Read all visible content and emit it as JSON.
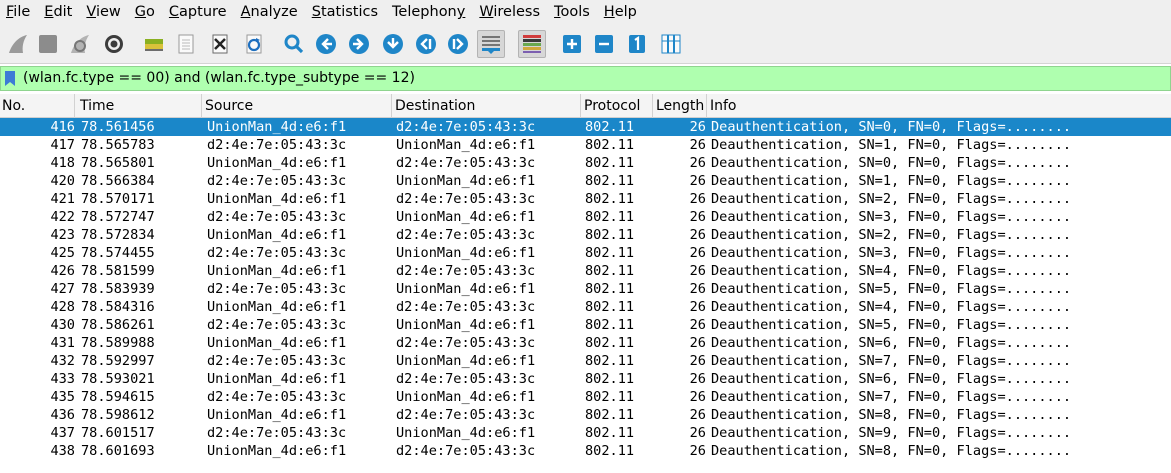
{
  "menu": [
    {
      "mnemonic": "F",
      "rest": "ile"
    },
    {
      "mnemonic": "E",
      "rest": "dit"
    },
    {
      "mnemonic": "V",
      "rest": "iew"
    },
    {
      "mnemonic": "G",
      "rest": "o"
    },
    {
      "mnemonic": "C",
      "rest": "apture"
    },
    {
      "mnemonic": "A",
      "rest": "nalyze"
    },
    {
      "mnemonic": "S",
      "rest": "tatistics"
    },
    {
      "mnemonic": "",
      "rest": "Telephon",
      "mnemonic_after": "y"
    },
    {
      "mnemonic": "W",
      "rest": "ireless"
    },
    {
      "mnemonic": "T",
      "rest": "ools"
    },
    {
      "mnemonic": "H",
      "rest": "elp"
    }
  ],
  "filter": {
    "expression": "(wlan.fc.type == 00) and (wlan.fc.type_subtype == 12)",
    "background": "#afffaf"
  },
  "columns": [
    "No.",
    "Time",
    "Source",
    "Destination",
    "Protocol",
    "Length",
    "Info"
  ],
  "selection_color": "#1a87c9",
  "rows": [
    {
      "no": "416",
      "time": "78.561456",
      "src": "UnionMan_4d:e6:f1",
      "dst": "d2:4e:7e:05:43:3c",
      "proto": "802.11",
      "len": "26",
      "info": "Deauthentication, SN=0, FN=0, Flags=........",
      "selected": true
    },
    {
      "no": "417",
      "time": "78.565783",
      "src": "d2:4e:7e:05:43:3c",
      "dst": "UnionMan_4d:e6:f1",
      "proto": "802.11",
      "len": "26",
      "info": "Deauthentication, SN=1, FN=0, Flags=........"
    },
    {
      "no": "418",
      "time": "78.565801",
      "src": "UnionMan_4d:e6:f1",
      "dst": "d2:4e:7e:05:43:3c",
      "proto": "802.11",
      "len": "26",
      "info": "Deauthentication, SN=0, FN=0, Flags=........"
    },
    {
      "no": "420",
      "time": "78.566384",
      "src": "d2:4e:7e:05:43:3c",
      "dst": "UnionMan_4d:e6:f1",
      "proto": "802.11",
      "len": "26",
      "info": "Deauthentication, SN=1, FN=0, Flags=........"
    },
    {
      "no": "421",
      "time": "78.570171",
      "src": "UnionMan_4d:e6:f1",
      "dst": "d2:4e:7e:05:43:3c",
      "proto": "802.11",
      "len": "26",
      "info": "Deauthentication, SN=2, FN=0, Flags=........"
    },
    {
      "no": "422",
      "time": "78.572747",
      "src": "d2:4e:7e:05:43:3c",
      "dst": "UnionMan_4d:e6:f1",
      "proto": "802.11",
      "len": "26",
      "info": "Deauthentication, SN=3, FN=0, Flags=........"
    },
    {
      "no": "423",
      "time": "78.572834",
      "src": "UnionMan_4d:e6:f1",
      "dst": "d2:4e:7e:05:43:3c",
      "proto": "802.11",
      "len": "26",
      "info": "Deauthentication, SN=2, FN=0, Flags=........"
    },
    {
      "no": "425",
      "time": "78.574455",
      "src": "d2:4e:7e:05:43:3c",
      "dst": "UnionMan_4d:e6:f1",
      "proto": "802.11",
      "len": "26",
      "info": "Deauthentication, SN=3, FN=0, Flags=........"
    },
    {
      "no": "426",
      "time": "78.581599",
      "src": "UnionMan_4d:e6:f1",
      "dst": "d2:4e:7e:05:43:3c",
      "proto": "802.11",
      "len": "26",
      "info": "Deauthentication, SN=4, FN=0, Flags=........"
    },
    {
      "no": "427",
      "time": "78.583939",
      "src": "d2:4e:7e:05:43:3c",
      "dst": "UnionMan_4d:e6:f1",
      "proto": "802.11",
      "len": "26",
      "info": "Deauthentication, SN=5, FN=0, Flags=........"
    },
    {
      "no": "428",
      "time": "78.584316",
      "src": "UnionMan_4d:e6:f1",
      "dst": "d2:4e:7e:05:43:3c",
      "proto": "802.11",
      "len": "26",
      "info": "Deauthentication, SN=4, FN=0, Flags=........"
    },
    {
      "no": "430",
      "time": "78.586261",
      "src": "d2:4e:7e:05:43:3c",
      "dst": "UnionMan_4d:e6:f1",
      "proto": "802.11",
      "len": "26",
      "info": "Deauthentication, SN=5, FN=0, Flags=........"
    },
    {
      "no": "431",
      "time": "78.589988",
      "src": "UnionMan_4d:e6:f1",
      "dst": "d2:4e:7e:05:43:3c",
      "proto": "802.11",
      "len": "26",
      "info": "Deauthentication, SN=6, FN=0, Flags=........"
    },
    {
      "no": "432",
      "time": "78.592997",
      "src": "d2:4e:7e:05:43:3c",
      "dst": "UnionMan_4d:e6:f1",
      "proto": "802.11",
      "len": "26",
      "info": "Deauthentication, SN=7, FN=0, Flags=........"
    },
    {
      "no": "433",
      "time": "78.593021",
      "src": "UnionMan_4d:e6:f1",
      "dst": "d2:4e:7e:05:43:3c",
      "proto": "802.11",
      "len": "26",
      "info": "Deauthentication, SN=6, FN=0, Flags=........"
    },
    {
      "no": "435",
      "time": "78.594615",
      "src": "d2:4e:7e:05:43:3c",
      "dst": "UnionMan_4d:e6:f1",
      "proto": "802.11",
      "len": "26",
      "info": "Deauthentication, SN=7, FN=0, Flags=........"
    },
    {
      "no": "436",
      "time": "78.598612",
      "src": "UnionMan_4d:e6:f1",
      "dst": "d2:4e:7e:05:43:3c",
      "proto": "802.11",
      "len": "26",
      "info": "Deauthentication, SN=8, FN=0, Flags=........"
    },
    {
      "no": "437",
      "time": "78.601517",
      "src": "d2:4e:7e:05:43:3c",
      "dst": "UnionMan_4d:e6:f1",
      "proto": "802.11",
      "len": "26",
      "info": "Deauthentication, SN=9, FN=0, Flags=........"
    },
    {
      "no": "438",
      "time": "78.601693",
      "src": "UnionMan_4d:e6:f1",
      "dst": "d2:4e:7e:05:43:3c",
      "proto": "802.11",
      "len": "26",
      "info": "Deauthentication, SN=8, FN=0, Flags=........"
    }
  ]
}
